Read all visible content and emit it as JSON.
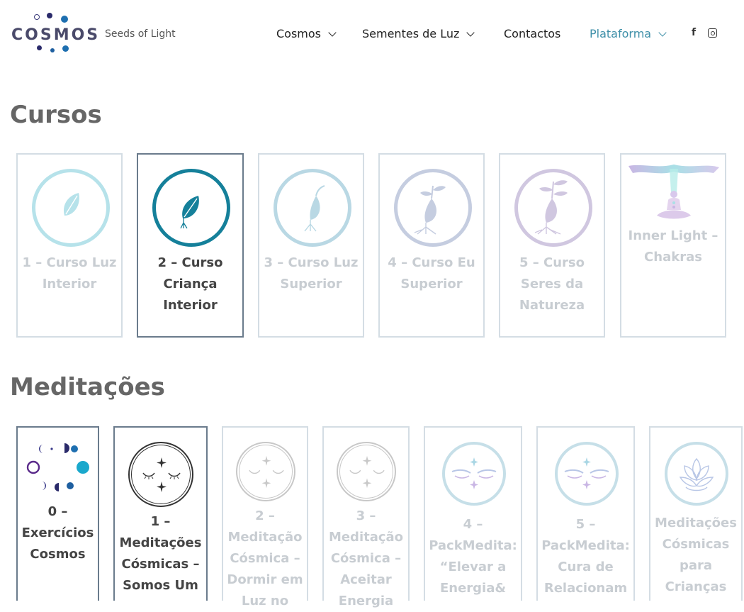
{
  "header": {
    "logo_text": "COSMOS",
    "tagline": "Seeds of Light",
    "nav": [
      {
        "label": "Cosmos",
        "has_dropdown": true
      },
      {
        "label": "Sementes de Luz",
        "has_dropdown": true
      },
      {
        "label": "Contactos",
        "has_dropdown": false
      },
      {
        "label": "Plataforma",
        "has_dropdown": true,
        "active": true
      }
    ],
    "social": {
      "facebook": "f"
    }
  },
  "colors": {
    "accent": "#3e8fa8",
    "selected_border": "#6a7b8c",
    "muted_text": "#c8cdd2"
  },
  "sections": {
    "courses": {
      "heading": "Cursos",
      "items": [
        {
          "title": "1 – Curso Luz Interior",
          "icon": "seed-icon",
          "selected": false
        },
        {
          "title": "2 – Curso Criança Interior",
          "icon": "seed-roots-icon",
          "selected": true
        },
        {
          "title": "3 – Curso Luz Superior",
          "icon": "sprout-icon",
          "selected": false
        },
        {
          "title": "4 – Curso Eu Superior",
          "icon": "sprout-leaves-icon",
          "selected": false
        },
        {
          "title": "5 – Curso Seres da Natureza",
          "icon": "plant-icon",
          "selected": false
        },
        {
          "title": "Inner Light – Chakras",
          "icon": "meditation-figure-icon",
          "selected": false
        }
      ]
    },
    "meditations": {
      "heading": "Meditações",
      "items": [
        {
          "title": "0 – Exercícios Cosmos",
          "icon": "moon-phases-icon",
          "selected": true
        },
        {
          "title": "1 – Meditações Cósmicas – Somos Um",
          "icon": "closed-eyes-stars-icon",
          "selected": true
        },
        {
          "title": "2 – Meditação Cósmica – Dormir em Luz no",
          "icon": "closed-eyes-stars-icon",
          "selected": false
        },
        {
          "title": "3 – Meditação Cósmica – Aceitar Energia",
          "icon": "closed-eyes-stars-icon",
          "selected": false
        },
        {
          "title": "4 – PackMedita: “Elevar a Energia&",
          "icon": "eyes-gradient-icon",
          "selected": false
        },
        {
          "title": "5 – PackMedita: Cura de Relacionam",
          "icon": "eyes-gradient-icon",
          "selected": false
        },
        {
          "title": "Meditações Cósmicas para Crianças",
          "icon": "lotus-icon",
          "selected": false
        }
      ]
    }
  }
}
